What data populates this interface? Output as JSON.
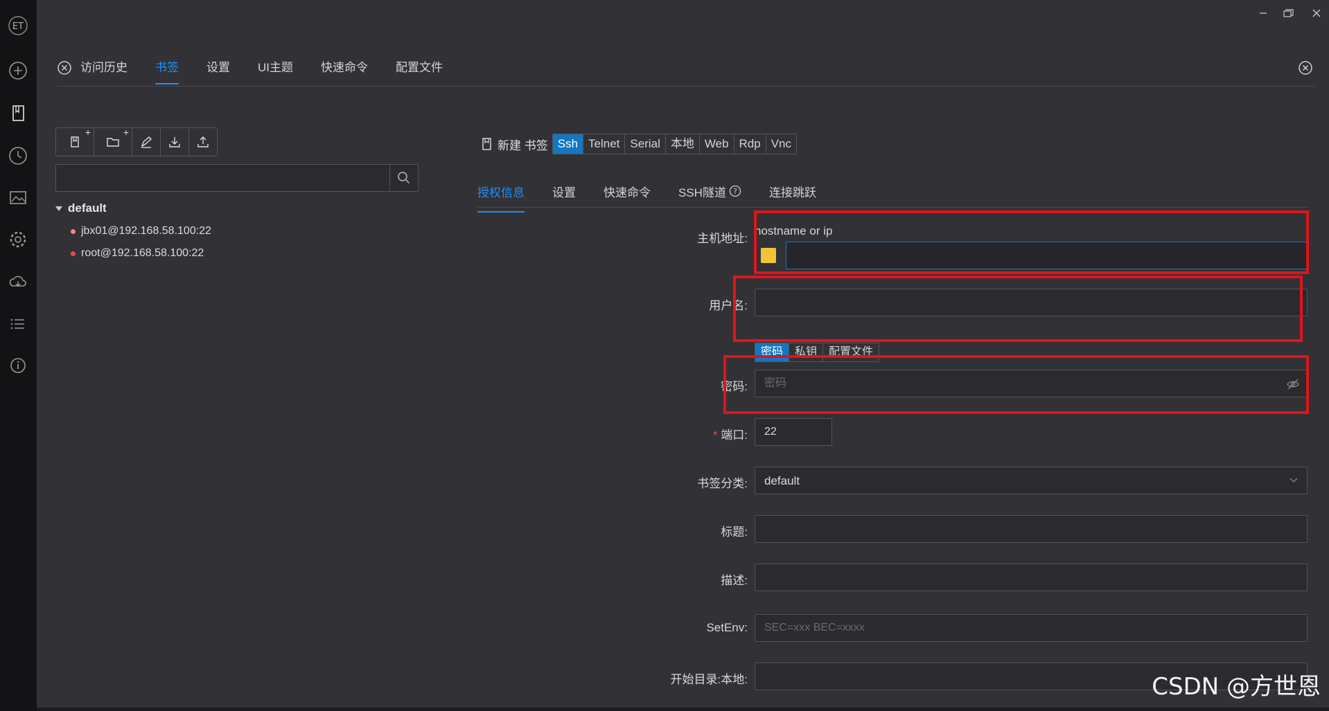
{
  "sidebar": {
    "logo": "ET",
    "icons": [
      "add-icon",
      "bookmark-icon",
      "history-icon",
      "image-icon",
      "gear-icon",
      "cloud-icon",
      "list-icon",
      "info-icon"
    ]
  },
  "main_tabs": [
    {
      "label": "访问历史"
    },
    {
      "label": "书签"
    },
    {
      "label": "设置"
    },
    {
      "label": "UI主题"
    },
    {
      "label": "快速命令"
    },
    {
      "label": "配置文件"
    }
  ],
  "tree": {
    "group": "default",
    "items": [
      {
        "label": "jbx01@192.168.58.100:22",
        "dot_color": "#e88a8a"
      },
      {
        "label": "root@192.168.58.100:22",
        "dot_color": "#e34b4b"
      }
    ]
  },
  "bookmark": {
    "new_label": "新建 书签",
    "types": [
      "Ssh",
      "Telnet",
      "Serial",
      "本地",
      "Web",
      "Rdp",
      "Vnc"
    ],
    "sub_tabs": [
      "授权信息",
      "设置",
      "快速命令",
      "SSH隧道",
      "连接跳跃"
    ]
  },
  "form": {
    "host_label": "主机地址:",
    "host_hint": "hostname or ip",
    "user_label": "用户名:",
    "auth_tabs": [
      "密码",
      "私钥",
      "配置文件"
    ],
    "password_label": "密码:",
    "password_placeholder": "密码",
    "port_label": "端口:",
    "port_value": "22",
    "category_label": "书签分类:",
    "category_value": "default",
    "title_label": "标题:",
    "desc_label": "描述:",
    "setenv_label": "SetEnv:",
    "setenv_placeholder": "SEC=xxx BEC=xxxx",
    "startdir_label": "开始目录:本地:"
  },
  "watermark": "CSDN @方世恩",
  "colors": {
    "accent": "#1e90ff",
    "annotation": "#e0141c",
    "host_color": "#f2c23a"
  }
}
